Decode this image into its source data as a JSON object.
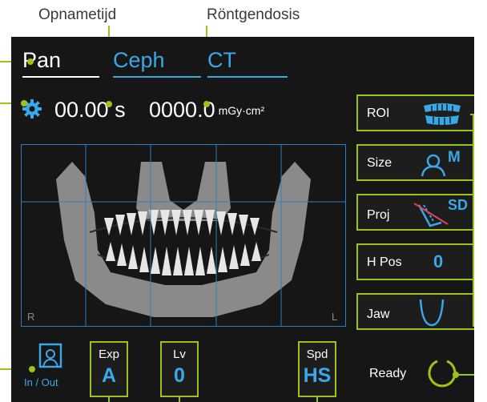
{
  "callouts": {
    "exposure_time": "Opnametijd",
    "dose": "Röntgendosis"
  },
  "tabs": [
    {
      "label": "Pan",
      "active": true
    },
    {
      "label": "Ceph",
      "active": false
    },
    {
      "label": "CT",
      "active": false
    }
  ],
  "readouts": {
    "time_value": "00.00 s",
    "dose_value": "0000.0",
    "dose_unit": "mGy·cm²"
  },
  "preview": {
    "left_marker": "R",
    "right_marker": "L"
  },
  "side_buttons": {
    "roi": {
      "label": "ROI",
      "icon": "dental-arch-icon"
    },
    "size": {
      "label": "Size",
      "value": "M",
      "icon": "patient-size-icon"
    },
    "proj": {
      "label": "Proj",
      "value": "SD",
      "icon": "projection-icon"
    },
    "hpos": {
      "label": "H Pos",
      "value": "0"
    },
    "jaw": {
      "label": "Jaw",
      "icon": "jaw-curve-icon"
    }
  },
  "bottom": {
    "inout_label": "In / Out",
    "exp": {
      "label": "Exp",
      "value": "A"
    },
    "lv": {
      "label": "Lv",
      "value": "0"
    },
    "spd": {
      "label": "Spd",
      "value": "HS"
    },
    "ready_label": "Ready"
  },
  "colors": {
    "accent_green": "#9bc31a",
    "accent_blue": "#39a8e8",
    "screen_bg": "#161616"
  }
}
